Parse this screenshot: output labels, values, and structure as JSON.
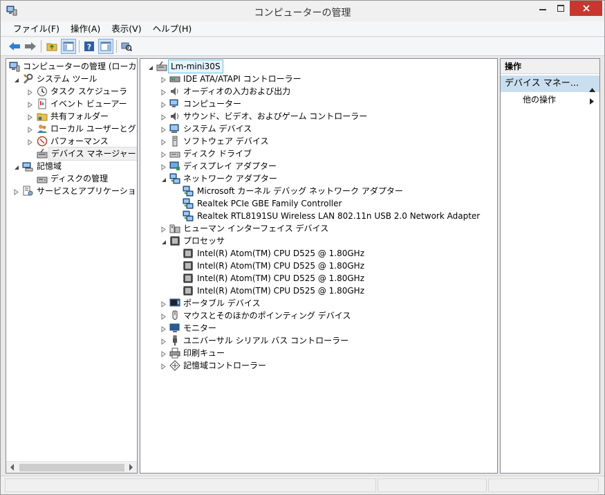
{
  "window": {
    "title": "コンピューターの管理"
  },
  "menu": {
    "file": "ファイル(F)",
    "action": "操作(A)",
    "view": "表示(V)",
    "help": "ヘルプ(H)"
  },
  "left_tree": {
    "root": "コンピューターの管理 (ローカル)",
    "system_tools": "システム ツール",
    "task_scheduler": "タスク スケジューラ",
    "event_viewer": "イベント ビューアー",
    "shared_folders": "共有フォルダー",
    "local_users": "ローカル ユーザーとグループ",
    "performance": "パフォーマンス",
    "device_manager": "デバイス マネージャー",
    "storage": "記憶域",
    "disk_management": "ディスクの管理",
    "services_apps": "サービスとアプリケーション"
  },
  "device_tree": {
    "root": "Lm-mini30S",
    "ide": "IDE ATA/ATAPI コントローラー",
    "audio_io": "オーディオの入力および出力",
    "computer": "コンピューター",
    "sound": "サウンド、ビデオ、およびゲーム コントローラー",
    "system_devices": "システム デバイス",
    "software_devices": "ソフトウェア デバイス",
    "disk_drives": "ディスク ドライブ",
    "display_adapters": "ディスプレイ アダプター",
    "network_adapters": "ネットワーク アダプター",
    "net_children": [
      "Microsoft カーネル デバッグ ネットワーク アダプター",
      "Realtek PCIe GBE Family Controller",
      "Realtek RTL8191SU Wireless LAN 802.11n USB 2.0 Network Adapter"
    ],
    "hid": "ヒューマン インターフェイス デバイス",
    "processors": "プロセッサ",
    "cpu_children": [
      "Intel(R) Atom(TM) CPU D525   @ 1.80GHz",
      "Intel(R) Atom(TM) CPU D525   @ 1.80GHz",
      "Intel(R) Atom(TM) CPU D525   @ 1.80GHz",
      "Intel(R) Atom(TM) CPU D525   @ 1.80GHz"
    ],
    "portable": "ポータブル デバイス",
    "mice": "マウスとそのほかのポインティング デバイス",
    "monitors": "モニター",
    "usb": "ユニバーサル シリアル バス コントローラー",
    "print_queues": "印刷キュー",
    "storage_controllers": "記憶域コントローラー"
  },
  "actions": {
    "header": "操作",
    "group": "デバイス マネー...",
    "other": "他の操作"
  },
  "colors": {
    "accent": "#c9dff0",
    "close": "#c7372f",
    "selection": "#e5f3fb"
  }
}
